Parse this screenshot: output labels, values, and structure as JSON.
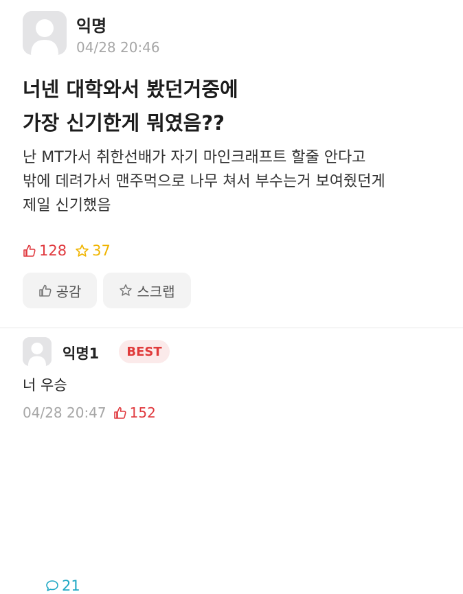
{
  "post": {
    "author": "익명",
    "time": "04/28 20:46",
    "title_lines": [
      "너넨 대학와서 봤던거중에",
      "가장 신기한게 뭐였음??"
    ],
    "body_lines": [
      "난 MT가서 취한선배가 자기 마인크래프트 할줄 안다고",
      "밖에 데려가서 맨주먹으로 나무 쳐서 부수는거 보여줬던게",
      "제일 신기했음"
    ],
    "stats": {
      "likes": "128",
      "comments": "21",
      "scraps": "37"
    },
    "buttons": {
      "like_label": "공감",
      "scrap_label": "스크랩"
    }
  },
  "comment": {
    "author": "익명1",
    "badge": "BEST",
    "text": "너 우승",
    "time": "04/28 20:47",
    "likes": "152"
  },
  "colors": {
    "like_red": "#e0393e",
    "comment_teal": "#1fa8c4",
    "scrap_yellow": "#f0b400",
    "muted_gray": "#a6a6a6",
    "button_bg": "#f3f3f3",
    "best_bg": "#fbeaea"
  },
  "icons": {
    "like": "thumbs-up-icon",
    "comment": "speech-bubble-icon",
    "scrap": "star-icon",
    "avatar": "default-user-avatar"
  }
}
